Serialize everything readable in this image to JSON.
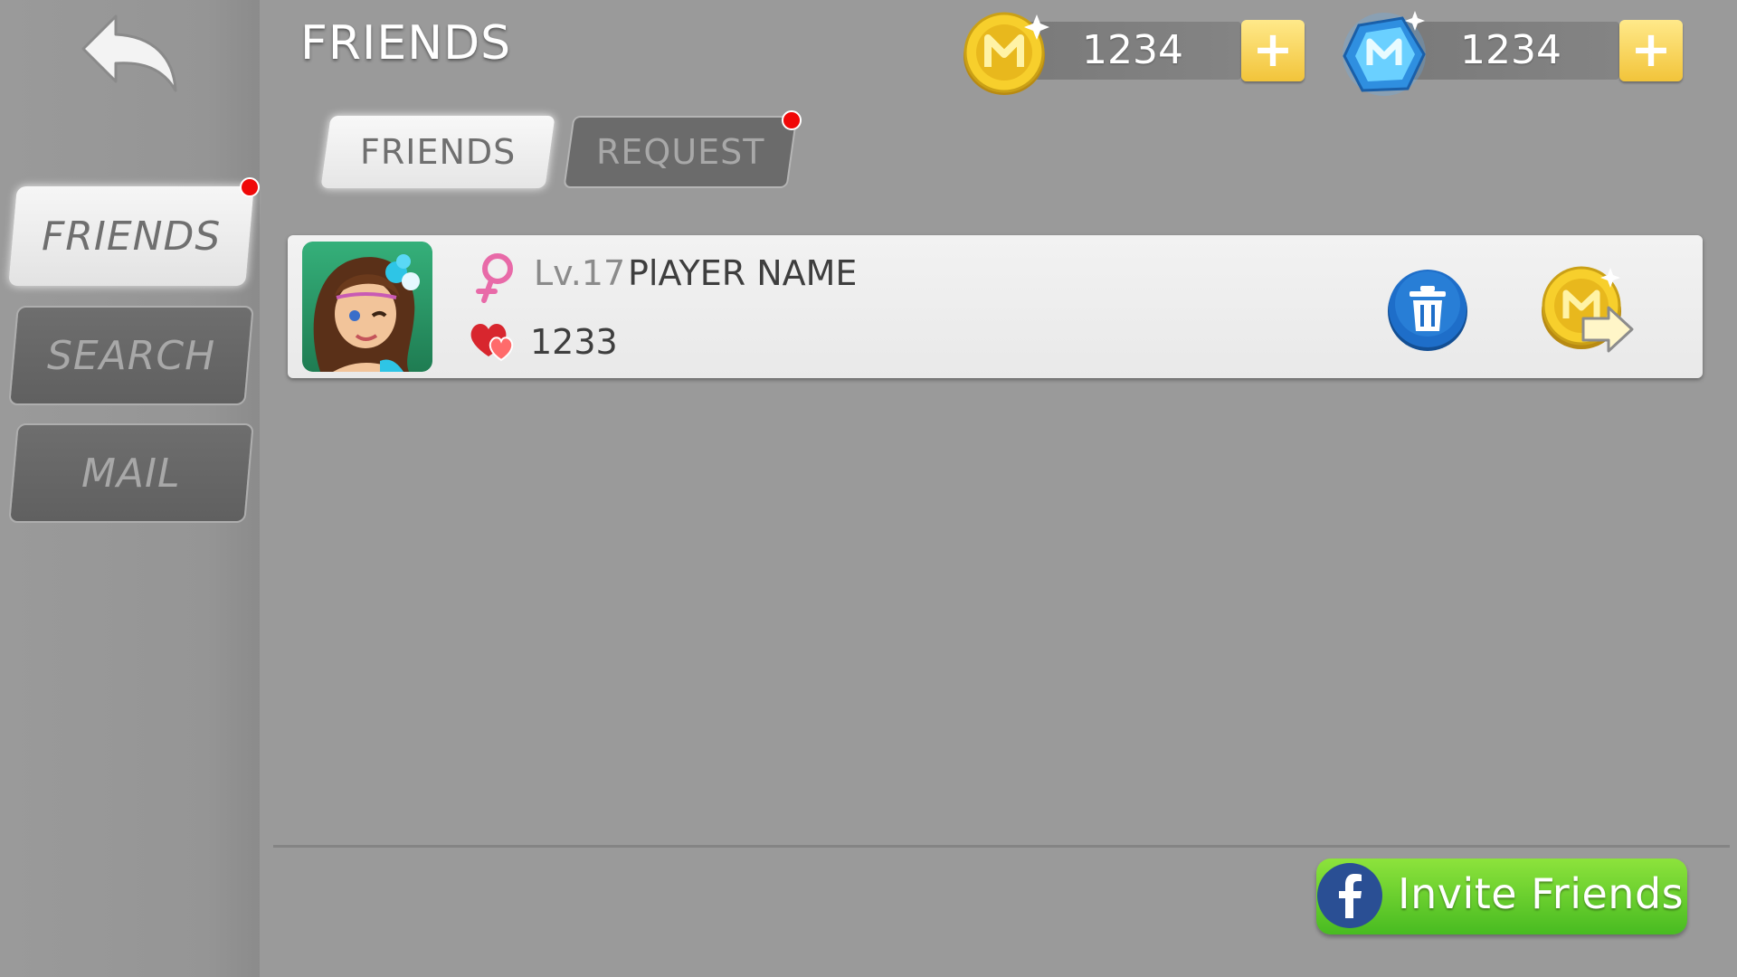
{
  "colors": {
    "background": "#9a9a9a",
    "notification_dot": "#f00808",
    "coin_gold": "#f2c43a",
    "gem_blue": "#3aa6e8",
    "invite_green": "#5bc92a",
    "delete_blue": "#1e6ec9"
  },
  "header": {
    "title": "FRIENDS",
    "back_icon": "back-arrow-icon"
  },
  "currencies": {
    "coins": {
      "icon": "gold-coin-icon",
      "amount": "1234",
      "add_label": "+"
    },
    "gems": {
      "icon": "blue-gem-icon",
      "amount": "1234",
      "add_label": "+"
    }
  },
  "sidebar": {
    "items": [
      {
        "label": "FRIENDS",
        "active": true,
        "notification": true
      },
      {
        "label": "SEARCH",
        "active": false,
        "notification": false
      },
      {
        "label": "MAIL",
        "active": false,
        "notification": false
      }
    ]
  },
  "tabs": [
    {
      "label": "FRIENDS",
      "active": true,
      "notification": false
    },
    {
      "label": "REQUEST",
      "active": false,
      "notification": true
    }
  ],
  "friends": [
    {
      "avatar": "female-avatar",
      "gender_icon": "female-symbol-icon",
      "level": "Lv.17",
      "name": "PlAYER NAME",
      "heart_icon": "hearts-icon",
      "hearts": "1233",
      "delete_icon": "trash-icon",
      "send_icon": "send-coin-icon"
    }
  ],
  "invite": {
    "label": "Invite Friends",
    "icon": "facebook-icon"
  }
}
